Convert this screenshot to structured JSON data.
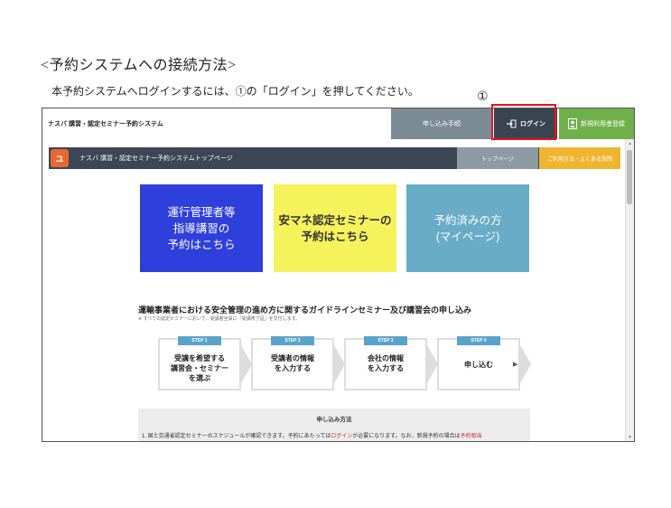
{
  "document": {
    "heading": "<予約システムへの接続方法>",
    "instruction": "本予約システムへログインするには、①の「ログイン」を押してください。",
    "callout_marker": "①"
  },
  "topbar": {
    "site_title": "ナスバ 講習・認定セミナー予約システム",
    "apply_label": "申し込み手順",
    "login_label": "ログイン",
    "register_label": "新規利用者登録"
  },
  "subbar": {
    "logo_text": "ユ",
    "title": "ナスバ 講習・認定セミナー予約システムトップページ",
    "top_label": "トップページ",
    "howto_label": "ご利用方法・よくある質問"
  },
  "tiles": [
    {
      "label": "運行管理者等\n指導講習の\n予約はこちら"
    },
    {
      "label": "安マネ認定セミナーの\n予約はこちら"
    },
    {
      "label": "予約済みの方\n(マイページ)"
    }
  ],
  "guideline": {
    "title": "運輸事業者における安全管理の進め方に関するガイドラインセミナー及び講習会の申し込み",
    "note": "※ すべての認定セミナーにおいて、受講者全員に「受講修了証」を交付します。"
  },
  "steps": [
    {
      "badge": "STEP 1",
      "text": "受講を希望する\n講習会・セミナー\nを選ぶ"
    },
    {
      "badge": "STEP 2",
      "text": "受講者の情報\nを入力する"
    },
    {
      "badge": "STEP 3",
      "text": "会社の情報\nを入力する"
    },
    {
      "badge": "STEP 4",
      "text": "申し込む"
    }
  ],
  "howto": {
    "title": "申し込み方法",
    "text_a": "1. 国土交通省認定セミナーのスケジュールが確認できます。予約にあたっては",
    "text_link": "ログイン",
    "text_b": "が必要になります。なお、新規予約の場合は",
    "text_link2": "予約相当"
  },
  "colors": {
    "tile_blue": "#2f3fdc",
    "tile_yellow": "#f6f25b",
    "tile_teal": "#68acc8",
    "highlight_red": "#e8141c",
    "register_green": "#6fb04b",
    "howto_orange": "#f0b530"
  },
  "icons": {
    "login": "login-arrow-icon",
    "register": "user-card-icon",
    "step_arrow": "chevron-right-icon"
  }
}
